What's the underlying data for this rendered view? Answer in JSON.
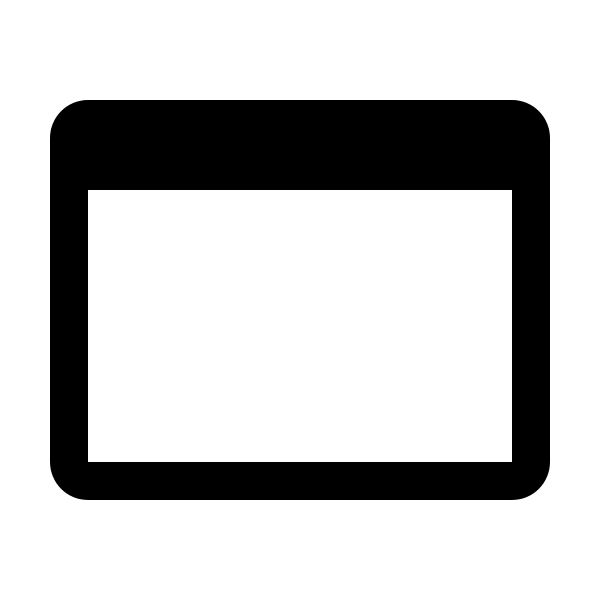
{
  "icon": {
    "name": "browser-window-icon",
    "frame_color": "#000000",
    "content_color": "#ffffff"
  },
  "page": {
    "background_color": "#ffffff"
  }
}
